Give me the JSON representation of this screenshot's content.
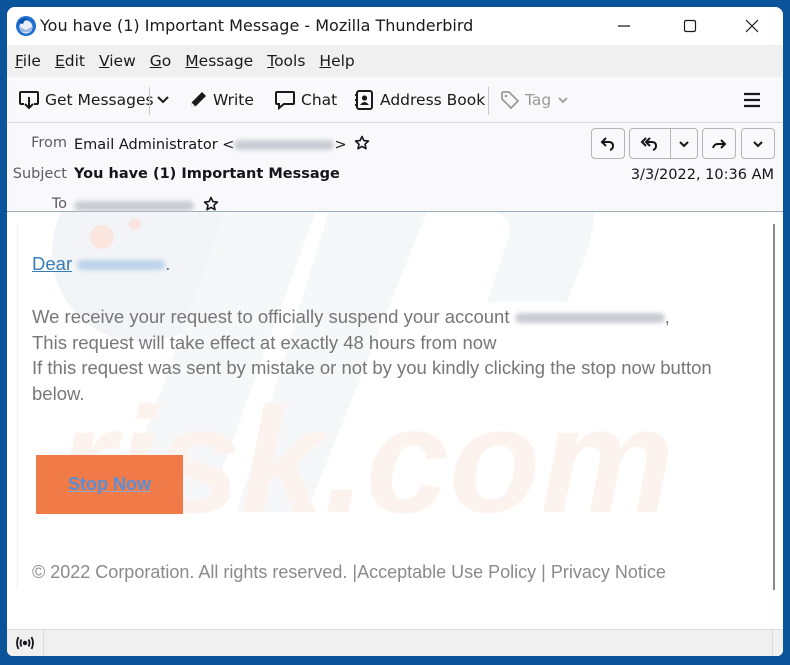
{
  "window": {
    "title": "You have (1) Important Message - Mozilla Thunderbird",
    "controls": {
      "minimize": "minimize",
      "maximize": "maximize",
      "close": "close"
    }
  },
  "menubar": {
    "items": [
      {
        "label_u": "F",
        "label_rest": "ile"
      },
      {
        "label_u": "E",
        "label_rest": "dit"
      },
      {
        "label_u": "V",
        "label_rest": "iew"
      },
      {
        "label_u": "G",
        "label_rest": "o"
      },
      {
        "label_u": "M",
        "label_rest": "essage"
      },
      {
        "label_u": "T",
        "label_rest": "ools"
      },
      {
        "label_u": "H",
        "label_rest": "elp"
      }
    ]
  },
  "toolbar": {
    "get_messages": "Get Messages",
    "write": "Write",
    "chat": "Chat",
    "address_book": "Address Book",
    "tag": "Tag"
  },
  "header": {
    "from_label": "From",
    "from_name": "Email Administrator <",
    "from_close": ">",
    "subject_label": "Subject",
    "subject": "You have (1) Important Message",
    "to_label": "To",
    "date": "3/3/2022, 10:36 AM"
  },
  "message": {
    "greeting": "Dear",
    "greeting_end": ".",
    "line1": "We receive your request to officially suspend your account",
    "line1_end": ",",
    "line2": "This request will take effect at exactly 48 hours from now",
    "line3": "If this request was sent by mistake or not by you kindly clicking the stop now button below.",
    "button": "Stop Now",
    "footer": "© 2022 Corporation. All rights reserved. |Acceptable Use Policy | Privacy Notice"
  },
  "colors": {
    "button_bg": "#f07a48",
    "link": "#3a7db5",
    "frame": "#0b5499"
  }
}
